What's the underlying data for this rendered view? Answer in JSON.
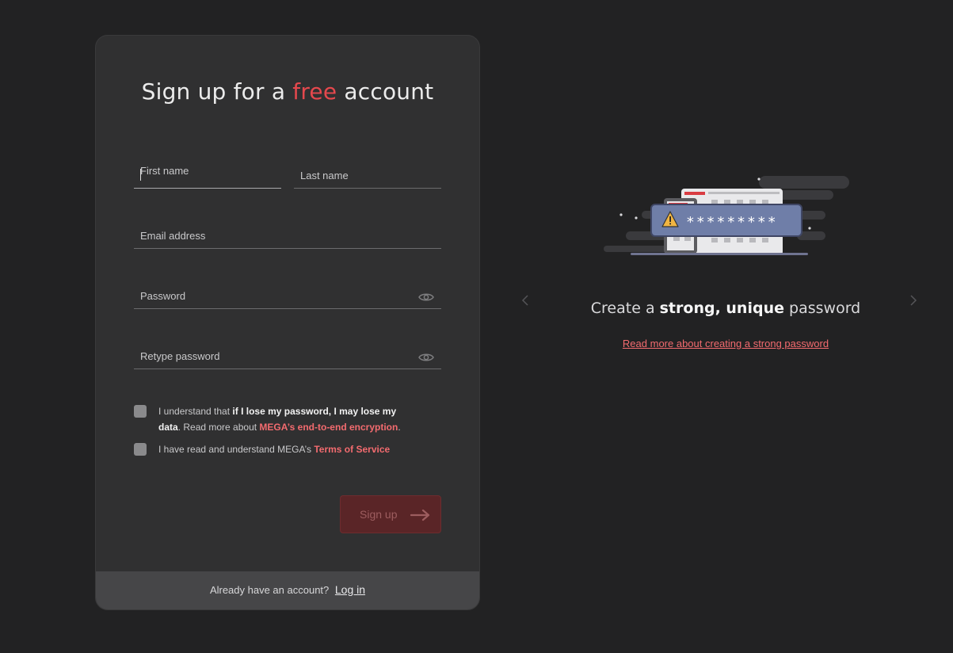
{
  "form": {
    "title_before": "Sign up for a ",
    "title_accent": "free",
    "title_after": " account",
    "first_name_label": "First name",
    "last_name_label": "Last name",
    "email_label": "Email address",
    "password_label": "Password",
    "retype_label": "Retype password",
    "consent1": {
      "pre": "I understand that ",
      "bold": "if I lose my password, I may lose my data",
      "mid": ". Read more about ",
      "link": "MEGA’s end-to-end encryption",
      "post": "."
    },
    "consent2": {
      "pre": "I have read and understand MEGA’s ",
      "link": "Terms of Service"
    },
    "signup_label": "Sign up"
  },
  "footer": {
    "prompt": "Already have an account?",
    "login_label": "Log in"
  },
  "slide": {
    "title_pre": "Create a ",
    "title_bold": "strong, unique",
    "title_post": " password",
    "link": "Read more about creating a strong password",
    "password_mask": "*********"
  },
  "colors": {
    "accent": "#e5484d",
    "link": "#f36b6f",
    "background": "#222223",
    "card": "#303031"
  }
}
